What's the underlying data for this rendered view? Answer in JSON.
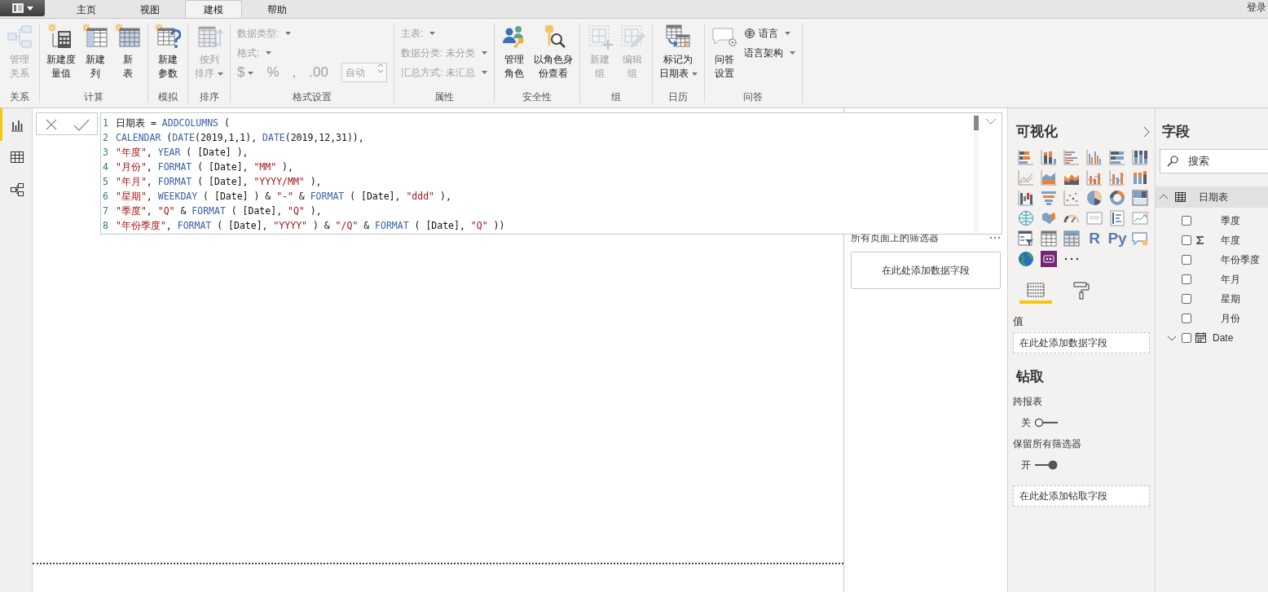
{
  "tabs": [
    {
      "label": "主页",
      "selected": false
    },
    {
      "label": "视图",
      "selected": false
    },
    {
      "label": "建模",
      "selected": true
    },
    {
      "label": "帮助",
      "selected": false
    }
  ],
  "account": "登录",
  "ribbon": [
    {
      "label": "关系",
      "items": [
        {
          "kind": "large",
          "lines": [
            "管理",
            "关系"
          ],
          "disabled": true,
          "dropdown": false
        }
      ]
    },
    {
      "label": "计算",
      "items": [
        {
          "kind": "large",
          "lines": [
            "新建度",
            "量值"
          ],
          "disabled": false,
          "dropdown": false
        },
        {
          "kind": "large",
          "lines": [
            "新建",
            "列"
          ],
          "disabled": false,
          "dropdown": false
        },
        {
          "kind": "large",
          "lines": [
            "新",
            "表"
          ],
          "disabled": false,
          "dropdown": false
        }
      ]
    },
    {
      "label": "模拟",
      "items": [
        {
          "kind": "large",
          "lines": [
            "新建",
            "参数"
          ],
          "disabled": false,
          "dropdown": false
        }
      ]
    },
    {
      "label": "排序",
      "items": [
        {
          "kind": "large",
          "lines": [
            "按列",
            "排序"
          ],
          "disabled": true,
          "dropdown": true
        }
      ]
    },
    {
      "label": "格式设置",
      "items": [
        {
          "kind": "field",
          "label": "数据类型:",
          "disabled": true,
          "dropdown": true
        },
        {
          "kind": "field",
          "label": "格式:",
          "disabled": true,
          "dropdown": true
        },
        {
          "kind": "format-row",
          "symbols": [
            {
              "t": "$",
              "dropdown": true
            },
            {
              "t": "%",
              "dropdown": false
            },
            {
              "t": ",",
              "dropdown": false
            },
            {
              "t": ".00",
              "dropdown": false
            }
          ],
          "spinner": "自动",
          "disabled": true
        }
      ]
    },
    {
      "label": "属性",
      "items": [
        {
          "kind": "field",
          "label": "主表:",
          "disabled": true,
          "dropdown": true
        },
        {
          "kind": "field",
          "label": "数据分类:",
          "value": "未分类",
          "disabled": true,
          "dropdown": true
        },
        {
          "kind": "field",
          "label": "汇总方式:",
          "value": "未汇总",
          "disabled": true,
          "dropdown": true
        }
      ]
    },
    {
      "label": "安全性",
      "items": [
        {
          "kind": "large",
          "lines": [
            "管理",
            "角色"
          ],
          "disabled": false,
          "dropdown": false
        },
        {
          "kind": "large",
          "lines": [
            "以角色身",
            "份查看"
          ],
          "disabled": false,
          "dropdown": false
        }
      ]
    },
    {
      "label": "组",
      "items": [
        {
          "kind": "large",
          "lines": [
            "新建",
            "组"
          ],
          "disabled": true,
          "dropdown": false
        },
        {
          "kind": "large",
          "lines": [
            "编辑",
            "组"
          ],
          "disabled": true,
          "dropdown": false
        }
      ]
    },
    {
      "label": "日历",
      "items": [
        {
          "kind": "large",
          "lines": [
            "标记为",
            "日期表"
          ],
          "disabled": false,
          "dropdown": true
        }
      ]
    },
    {
      "label": "问答",
      "items": [
        {
          "kind": "large",
          "lines": [
            "问答",
            "设置"
          ],
          "disabled": false,
          "dropdown": false
        },
        {
          "kind": "small",
          "label": "语言",
          "disabled": false,
          "dropdown": true
        },
        {
          "kind": "small",
          "label": "语言架构",
          "disabled": false,
          "dropdown": true
        }
      ]
    }
  ],
  "rail": [
    {
      "selected": true
    },
    {
      "selected": false
    },
    {
      "selected": false
    }
  ],
  "formula": {
    "lines": [
      {
        "number": "1",
        "code": "日期表 = ADDCOLUMNS ("
      },
      {
        "number": "2",
        "code": "CALENDAR (DATE(2019,1,1), DATE(2019,12,31)),"
      },
      {
        "number": "3",
        "code": "\"年度\", YEAR ( [Date] ),"
      },
      {
        "number": "4",
        "code": "\"月份\", FORMAT ( [Date], \"MM\" ),"
      },
      {
        "number": "5",
        "code": "\"年月\", FORMAT ( [Date], \"YYYY/MM\" ),"
      },
      {
        "number": "6",
        "code": "\"星期\", WEEKDAY ( [Date] ) & \"-\" & FORMAT ( [Date], \"ddd\" ),"
      },
      {
        "number": "7",
        "code": "\"季度\", \"Q\" & FORMAT ( [Date], \"Q\" ),"
      },
      {
        "number": "8",
        "code": "\"年份季度\", FORMAT ( [Date], \"YYYY\" ) & \"/Q\" & FORMAT ( [Date], \"Q\" ))"
      }
    ]
  },
  "filters": {
    "heading": "所有页面上的筛选器",
    "drop_zone": "在此处添加数据字段"
  },
  "visualizations": {
    "title": "可视化",
    "types": [
      {
        "kind": "stacked-bar"
      },
      {
        "kind": "stacked-column"
      },
      {
        "kind": "clustered-bar"
      },
      {
        "kind": "clustered-column"
      },
      {
        "kind": "bar-100"
      },
      {
        "kind": "column-100"
      },
      {
        "kind": "line"
      },
      {
        "kind": "area"
      },
      {
        "kind": "stacked-area"
      },
      {
        "kind": "line-column"
      },
      {
        "kind": "line-column-2"
      },
      {
        "kind": "ribbon"
      },
      {
        "kind": "waterfall"
      },
      {
        "kind": "funnel"
      },
      {
        "kind": "scatter"
      },
      {
        "kind": "pie"
      },
      {
        "kind": "donut"
      },
      {
        "kind": "treemap"
      },
      {
        "kind": "map"
      },
      {
        "kind": "filled-map"
      },
      {
        "kind": "gauge"
      },
      {
        "kind": "card"
      },
      {
        "kind": "multirow-card"
      },
      {
        "kind": "kpi"
      },
      {
        "kind": "slicer"
      },
      {
        "kind": "table"
      },
      {
        "kind": "matrix"
      },
      {
        "kind": "script",
        "label": "R"
      },
      {
        "kind": "script",
        "label": "Py"
      },
      {
        "kind": "qa-visual"
      },
      {
        "kind": "arcgis"
      },
      {
        "kind": "custom"
      },
      {
        "kind": "more"
      }
    ],
    "tabs": [
      {
        "selected": true
      },
      {
        "selected": false
      }
    ],
    "values_label": "值",
    "values_drop": "在此处添加数据字段",
    "drill_title": "钻取",
    "toggles": [
      {
        "label": "跨报表",
        "state": "关",
        "on": false
      },
      {
        "label": "保留所有筛选器",
        "state": "开",
        "on": true
      }
    ],
    "drill_drop": "在此处添加钻取字段"
  },
  "fields": {
    "title": "字段",
    "search_placeholder": "搜索",
    "tables": [
      {
        "name": "日期表",
        "expanded": true,
        "columns": [
          {
            "name": "季度",
            "kind": "text",
            "checked": false
          },
          {
            "name": "年度",
            "kind": "sum",
            "checked": false
          },
          {
            "name": "年份季度",
            "kind": "text",
            "checked": false
          },
          {
            "name": "年月",
            "kind": "text",
            "checked": false
          },
          {
            "name": "星期",
            "kind": "text",
            "checked": false
          },
          {
            "name": "月份",
            "kind": "text",
            "checked": false
          },
          {
            "name": "Date",
            "kind": "date",
            "checked": false,
            "expanded": false
          }
        ]
      }
    ]
  }
}
